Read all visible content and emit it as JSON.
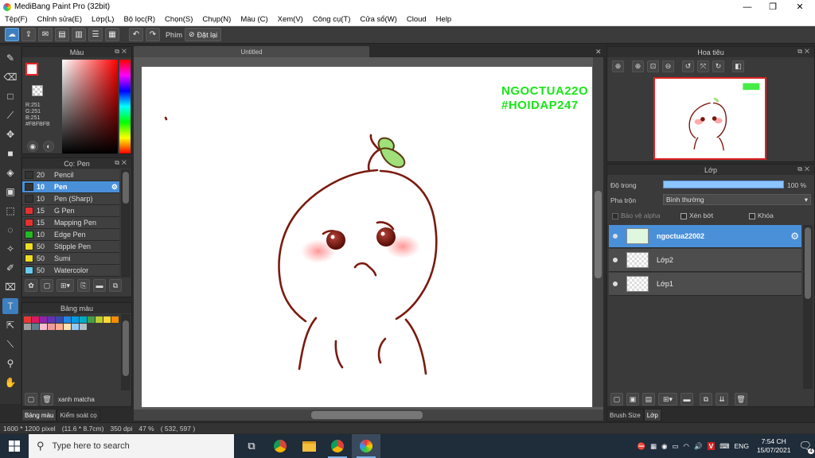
{
  "window": {
    "title": "MediBang Paint Pro (32bit)",
    "minimize": "—",
    "maximize": "❐",
    "close": "✕"
  },
  "menu": [
    "Tệp(F)",
    "Chỉnh sửa(E)",
    "Lớp(L)",
    "Bộ lọc(R)",
    "Chọn(S)",
    "Chụp(N)",
    "Màu (C)",
    "Xem(V)",
    "Công cụ(T)",
    "Cửa sổ(W)",
    "Cloud",
    "Help"
  ],
  "toolbar": {
    "phim_label": "Phím",
    "reset_label": "Đặt lại"
  },
  "color_panel": {
    "title": "Màu",
    "r": "R:251",
    "g": "G:251",
    "b": "B:251",
    "hex": "#FBFBFB",
    "fg": "#fbfbfb"
  },
  "brush_panel": {
    "title": "Cọ: Pen",
    "brushes": [
      {
        "size": "20",
        "name": "Pencil",
        "color": "#333333"
      },
      {
        "size": "10",
        "name": "Pen",
        "color": "#333333",
        "selected": true
      },
      {
        "size": "10",
        "name": "Pen (Sharp)",
        "color": "#333333"
      },
      {
        "size": "15",
        "name": "G Pen",
        "color": "#e53030"
      },
      {
        "size": "15",
        "name": "Mapping Pen",
        "color": "#e53030"
      },
      {
        "size": "10",
        "name": "Edge Pen",
        "color": "#22bb22"
      },
      {
        "size": "50",
        "name": "Stipple Pen",
        "color": "#eedd22"
      },
      {
        "size": "50",
        "name": "Sumi",
        "color": "#eedd22"
      },
      {
        "size": "50",
        "name": "Watercolor",
        "color": "#66ccee"
      }
    ]
  },
  "palette_panel": {
    "title": "Bảng màu",
    "swatches": [
      "#e53935",
      "#d81b60",
      "#8e24aa",
      "#5e35b1",
      "#3949ab",
      "#1e88e5",
      "#039be5",
      "#00acc1",
      "#43a047",
      "#c0ca33",
      "#fdd835",
      "#fb8c00",
      "#9e9e9e",
      "#607d8b",
      "#f8bbd0",
      "#ef9a9a",
      "#ffab91",
      "#ffe0b2",
      "#90caf9",
      "#b0bec5"
    ],
    "name": "xanh matcha"
  },
  "left_tabs": [
    "Bảng màu",
    "Kiểm soát cọ"
  ],
  "canvas": {
    "tab": "Untitled",
    "text_line1": "NGOCTUA22O",
    "text_line2": "#HOIDAP247"
  },
  "navigator": {
    "title": "Hoa tiêu"
  },
  "layer_panel": {
    "title": "Lớp",
    "opacity_label": "Độ trong",
    "opacity_value": "100 %",
    "opacity": 1.0,
    "blend_label": "Pha trộn",
    "blend_value": "Bình thường",
    "protect_alpha": "Bảo vệ alpha",
    "clipping": "Xén bớt",
    "lock": "Khóa",
    "layers": [
      {
        "name": "ngoctua22002",
        "selected": true
      },
      {
        "name": "Lớp2",
        "selected": false
      },
      {
        "name": "Lớp1",
        "selected": false
      }
    ]
  },
  "right_tabs": [
    "Brush Size",
    "Lớp"
  ],
  "status": {
    "size": "1600 * 1200 pixel",
    "cm": "(11.6 * 8.7cm)",
    "dpi": "350 dpi",
    "zoom": "47 %",
    "coords": "( 532, 597 )"
  },
  "taskbar": {
    "search_placeholder": "Type here to search",
    "lang": "ENG",
    "time": "7:54 CH",
    "date": "15/07/2021",
    "notifications": "4"
  },
  "colors": {
    "accent": "#4a90d9",
    "canvas_text": "#19e619",
    "line_art": "#7a1a10"
  }
}
